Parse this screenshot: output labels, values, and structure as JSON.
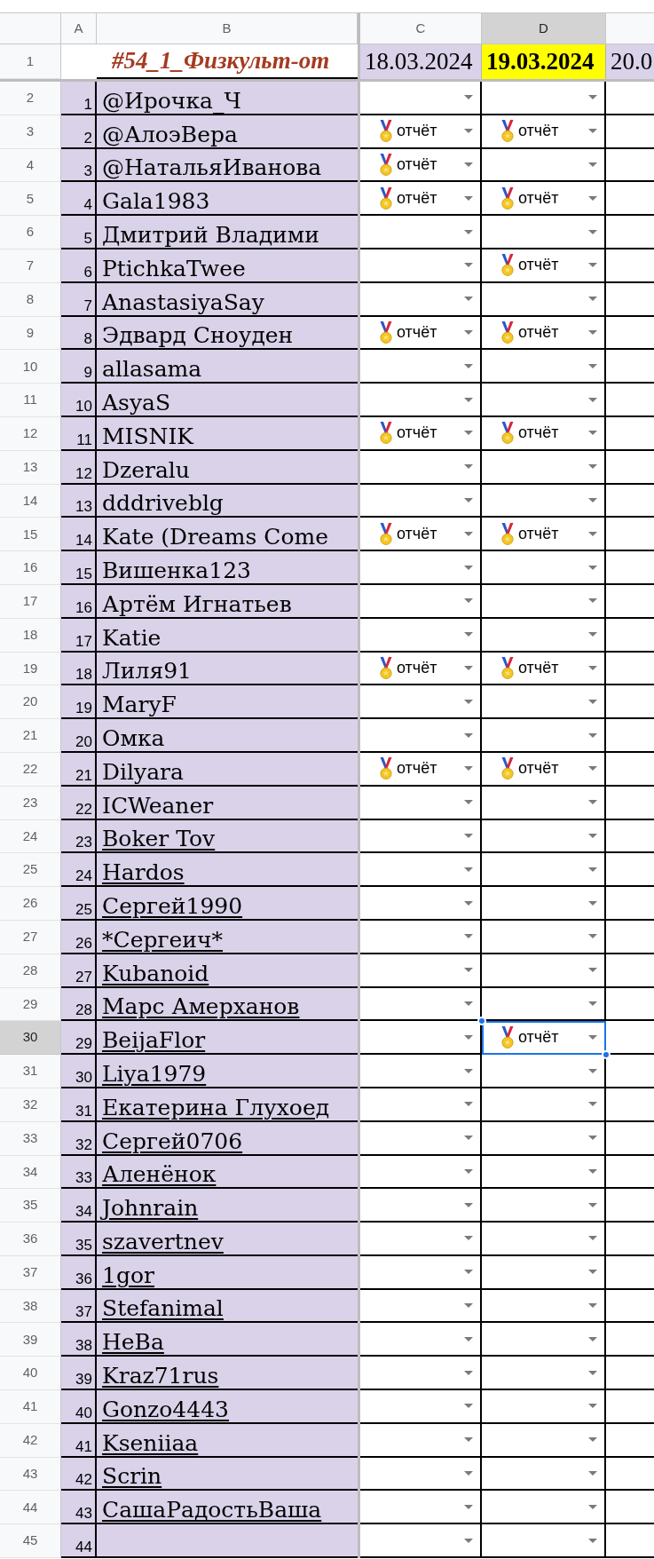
{
  "column_headers": [
    {
      "label": "A",
      "selected": false
    },
    {
      "label": "B",
      "selected": false
    },
    {
      "label": "C",
      "selected": false
    },
    {
      "label": "D",
      "selected": true
    }
  ],
  "header_row": {
    "row_number": "1",
    "selected": false,
    "title": "#54_1_Физкульт-от",
    "dates": [
      {
        "text": "18.03.2024",
        "highlighted": false
      },
      {
        "text": "19.03.2024",
        "highlighted": true
      },
      {
        "text": "20.0",
        "highlighted": false
      }
    ]
  },
  "rows": [
    {
      "row_number": "2",
      "selected": false,
      "index": "1",
      "name": "@Ирочка_Ч",
      "underlined": false,
      "cells": [
        {
          "selected": false
        },
        {
          "selected": false
        }
      ]
    },
    {
      "row_number": "3",
      "selected": false,
      "index": "2",
      "name": "@АлоэВера",
      "underlined": false,
      "cells": [
        {
          "value": "отчёт",
          "selected": false
        },
        {
          "value": "отчёт",
          "selected": false
        }
      ]
    },
    {
      "row_number": "4",
      "selected": false,
      "index": "3",
      "name": "@НатальяИванова",
      "underlined": false,
      "cells": [
        {
          "value": "отчёт",
          "selected": false
        },
        {
          "selected": false
        }
      ]
    },
    {
      "row_number": "5",
      "selected": false,
      "index": "4",
      "name": "Gala1983",
      "underlined": false,
      "cells": [
        {
          "value": "отчёт",
          "selected": false
        },
        {
          "value": "отчёт",
          "selected": false
        }
      ]
    },
    {
      "row_number": "6",
      "selected": false,
      "index": "5",
      "name": "Дмитрий Владими",
      "underlined": false,
      "cells": [
        {
          "selected": false
        },
        {
          "selected": false
        }
      ]
    },
    {
      "row_number": "7",
      "selected": false,
      "index": "6",
      "name": "PtichkaTwee",
      "underlined": false,
      "cells": [
        {
          "selected": false
        },
        {
          "value": "отчёт",
          "selected": false
        }
      ]
    },
    {
      "row_number": "8",
      "selected": false,
      "index": "7",
      "name": "AnastasiyaSay",
      "underlined": false,
      "cells": [
        {
          "selected": false
        },
        {
          "selected": false
        }
      ]
    },
    {
      "row_number": "9",
      "selected": false,
      "index": "8",
      "name": "Эдвард Сноуден",
      "underlined": false,
      "cells": [
        {
          "value": "отчёт",
          "selected": false
        },
        {
          "value": "отчёт",
          "selected": false
        }
      ]
    },
    {
      "row_number": "10",
      "selected": false,
      "index": "9",
      "name": "allasama",
      "underlined": false,
      "cells": [
        {
          "selected": false
        },
        {
          "selected": false
        }
      ]
    },
    {
      "row_number": "11",
      "selected": false,
      "index": "10",
      "name": "AsyaS",
      "underlined": false,
      "cells": [
        {
          "selected": false
        },
        {
          "selected": false
        }
      ]
    },
    {
      "row_number": "12",
      "selected": false,
      "index": "11",
      "name": "MISNIK",
      "underlined": false,
      "cells": [
        {
          "value": "отчёт",
          "selected": false
        },
        {
          "value": "отчёт",
          "selected": false
        }
      ]
    },
    {
      "row_number": "13",
      "selected": false,
      "index": "12",
      "name": "Dzeralu",
      "underlined": false,
      "cells": [
        {
          "selected": false
        },
        {
          "selected": false
        }
      ]
    },
    {
      "row_number": "14",
      "selected": false,
      "index": "13",
      "name": "dddriveblg",
      "underlined": false,
      "cells": [
        {
          "selected": false
        },
        {
          "selected": false
        }
      ]
    },
    {
      "row_number": "15",
      "selected": false,
      "index": "14",
      "name": "Kate (Dreams Come",
      "underlined": false,
      "cells": [
        {
          "value": "отчёт",
          "selected": false
        },
        {
          "value": "отчёт",
          "selected": false
        }
      ]
    },
    {
      "row_number": "16",
      "selected": false,
      "index": "15",
      "name": "Вишенка123",
      "underlined": false,
      "cells": [
        {
          "selected": false
        },
        {
          "selected": false
        }
      ]
    },
    {
      "row_number": "17",
      "selected": false,
      "index": "16",
      "name": "Артём Игнатьев",
      "underlined": false,
      "cells": [
        {
          "selected": false
        },
        {
          "selected": false
        }
      ]
    },
    {
      "row_number": "18",
      "selected": false,
      "index": "17",
      "name": "Katie",
      "underlined": false,
      "cells": [
        {
          "selected": false
        },
        {
          "selected": false
        }
      ]
    },
    {
      "row_number": "19",
      "selected": false,
      "index": "18",
      "name": "Лиля91",
      "underlined": false,
      "cells": [
        {
          "value": "отчёт",
          "selected": false
        },
        {
          "value": "отчёт",
          "selected": false
        }
      ]
    },
    {
      "row_number": "20",
      "selected": false,
      "index": "19",
      "name": "MaryF",
      "underlined": false,
      "cells": [
        {
          "selected": false
        },
        {
          "selected": false
        }
      ]
    },
    {
      "row_number": "21",
      "selected": false,
      "index": "20",
      "name": "Омка",
      "underlined": false,
      "cells": [
        {
          "selected": false
        },
        {
          "selected": false
        }
      ]
    },
    {
      "row_number": "22",
      "selected": false,
      "index": "21",
      "name": "Dilyara",
      "underlined": false,
      "cells": [
        {
          "value": "отчёт",
          "selected": false
        },
        {
          "value": "отчёт",
          "selected": false
        }
      ]
    },
    {
      "row_number": "23",
      "selected": false,
      "index": "22",
      "name": "ICWeaner",
      "underlined": false,
      "cells": [
        {
          "selected": false
        },
        {
          "selected": false
        }
      ]
    },
    {
      "row_number": "24",
      "selected": false,
      "index": "23",
      "name": "Boker Tov",
      "underlined": true,
      "cells": [
        {
          "selected": false
        },
        {
          "selected": false
        }
      ]
    },
    {
      "row_number": "25",
      "selected": false,
      "index": "24",
      "name": "Hardos",
      "underlined": true,
      "cells": [
        {
          "selected": false
        },
        {
          "selected": false
        }
      ]
    },
    {
      "row_number": "26",
      "selected": false,
      "index": "25",
      "name": "Сергей1990",
      "underlined": true,
      "cells": [
        {
          "selected": false
        },
        {
          "selected": false
        }
      ]
    },
    {
      "row_number": "27",
      "selected": false,
      "index": "26",
      "name": "*Сергеич*",
      "underlined": true,
      "cells": [
        {
          "selected": false
        },
        {
          "selected": false
        }
      ]
    },
    {
      "row_number": "28",
      "selected": false,
      "index": "27",
      "name": "Kubanoid",
      "underlined": true,
      "cells": [
        {
          "selected": false
        },
        {
          "selected": false
        }
      ]
    },
    {
      "row_number": "29",
      "selected": false,
      "index": "28",
      "name": "Марс Амерханов",
      "underlined": true,
      "cells": [
        {
          "selected": false
        },
        {
          "selected": false
        }
      ]
    },
    {
      "row_number": "30",
      "selected": true,
      "index": "29",
      "name": "BeijaFlor",
      "underlined": true,
      "cells": [
        {
          "selected": false
        },
        {
          "value": "отчёт",
          "selected": true
        }
      ]
    },
    {
      "row_number": "31",
      "selected": false,
      "index": "30",
      "name": "Liya1979",
      "underlined": true,
      "cells": [
        {
          "selected": false
        },
        {
          "selected": false
        }
      ]
    },
    {
      "row_number": "32",
      "selected": false,
      "index": "31",
      "name": "Екатерина Глухоед",
      "underlined": true,
      "cells": [
        {
          "selected": false
        },
        {
          "selected": false
        }
      ]
    },
    {
      "row_number": "33",
      "selected": false,
      "index": "32",
      "name": "Сергей0706",
      "underlined": true,
      "cells": [
        {
          "selected": false
        },
        {
          "selected": false
        }
      ]
    },
    {
      "row_number": "34",
      "selected": false,
      "index": "33",
      "name": "Аленёнок",
      "underlined": true,
      "cells": [
        {
          "selected": false
        },
        {
          "selected": false
        }
      ]
    },
    {
      "row_number": "35",
      "selected": false,
      "index": "34",
      "name": "Johnrain",
      "underlined": true,
      "cells": [
        {
          "selected": false
        },
        {
          "selected": false
        }
      ]
    },
    {
      "row_number": "36",
      "selected": false,
      "index": "35",
      "name": "szavertnev",
      "underlined": true,
      "cells": [
        {
          "selected": false
        },
        {
          "selected": false
        }
      ]
    },
    {
      "row_number": "37",
      "selected": false,
      "index": "36",
      "name": "1gor",
      "underlined": true,
      "cells": [
        {
          "selected": false
        },
        {
          "selected": false
        }
      ]
    },
    {
      "row_number": "38",
      "selected": false,
      "index": "37",
      "name": "Stefanimal",
      "underlined": true,
      "cells": [
        {
          "selected": false
        },
        {
          "selected": false
        }
      ]
    },
    {
      "row_number": "39",
      "selected": false,
      "index": "38",
      "name": "НеВа",
      "underlined": true,
      "cells": [
        {
          "selected": false
        },
        {
          "selected": false
        }
      ]
    },
    {
      "row_number": "40",
      "selected": false,
      "index": "39",
      "name": "Kraz71rus",
      "underlined": true,
      "cells": [
        {
          "selected": false
        },
        {
          "selected": false
        }
      ]
    },
    {
      "row_number": "41",
      "selected": false,
      "index": "40",
      "name": "Gonzo4443",
      "underlined": true,
      "cells": [
        {
          "selected": false
        },
        {
          "selected": false
        }
      ]
    },
    {
      "row_number": "42",
      "selected": false,
      "index": "41",
      "name": "Kseniiaa",
      "underlined": true,
      "cells": [
        {
          "selected": false
        },
        {
          "selected": false
        }
      ]
    },
    {
      "row_number": "43",
      "selected": false,
      "index": "42",
      "name": "Scrin",
      "underlined": true,
      "cells": [
        {
          "selected": false
        },
        {
          "selected": false
        }
      ]
    },
    {
      "row_number": "44",
      "selected": false,
      "index": "43",
      "name": "СашаРадостьВаша",
      "underlined": true,
      "cells": [
        {
          "selected": false
        },
        {
          "selected": false
        }
      ]
    },
    {
      "row_number": "45",
      "selected": false,
      "index": "44",
      "cells": [
        {
          "selected": false
        },
        {
          "selected": false
        }
      ]
    }
  ]
}
